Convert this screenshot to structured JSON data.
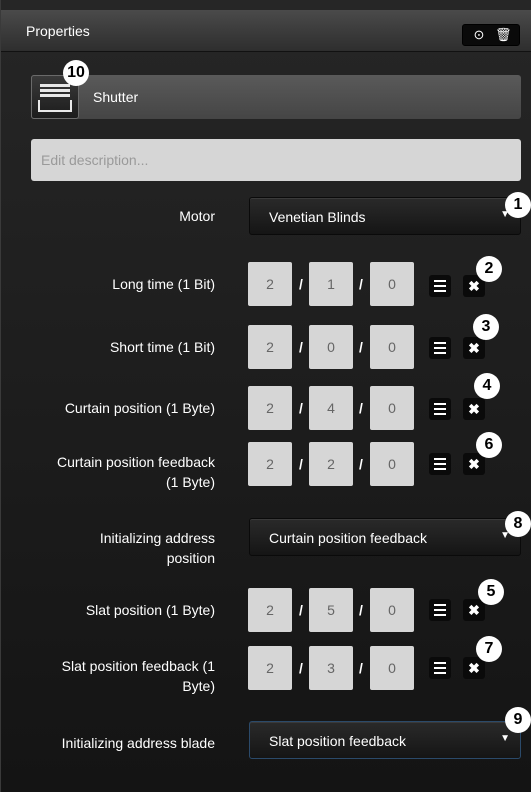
{
  "panel": {
    "title": "Properties",
    "toolbar_icons": [
      "check-circle-icon",
      "trash-icon"
    ],
    "device_name": "Shutter",
    "device_icon": "shutter-icon",
    "description_placeholder": "Edit description..."
  },
  "fields": {
    "motor": {
      "label": "Motor",
      "value": "Venetian Blinds"
    },
    "long_time": {
      "label": "Long time (1 Bit)",
      "a": "2",
      "b": "1",
      "c": "0"
    },
    "short_time": {
      "label": "Short time (1 Bit)",
      "a": "2",
      "b": "0",
      "c": "0"
    },
    "curtain_position": {
      "label": "Curtain position (1 Byte)",
      "a": "2",
      "b": "4",
      "c": "0"
    },
    "curtain_position_feedback": {
      "label_1": "Curtain position feedback",
      "label_2": "(1 Byte)",
      "a": "2",
      "b": "2",
      "c": "0"
    },
    "init_address_position": {
      "label_1": "Initializing address",
      "label_2": "position",
      "value": "Curtain position feedback"
    },
    "slat_position": {
      "label": "Slat position (1 Byte)",
      "a": "2",
      "b": "5",
      "c": "0"
    },
    "slat_position_feedback": {
      "label_1": "Slat position feedback (1",
      "label_2": "Byte)",
      "a": "2",
      "b": "3",
      "c": "0"
    },
    "init_address_blade": {
      "label": "Initializing address blade",
      "value": "Slat position feedback"
    }
  },
  "address_separator": "/",
  "callouts": {
    "device": "10",
    "motor": "1",
    "long_time": "2",
    "short_time": "3",
    "curtain_position": "4",
    "curtain_position_feedback": "6",
    "init_address_position": "8",
    "slat_position": "5",
    "slat_position_feedback": "7",
    "init_address_blade": "9"
  }
}
